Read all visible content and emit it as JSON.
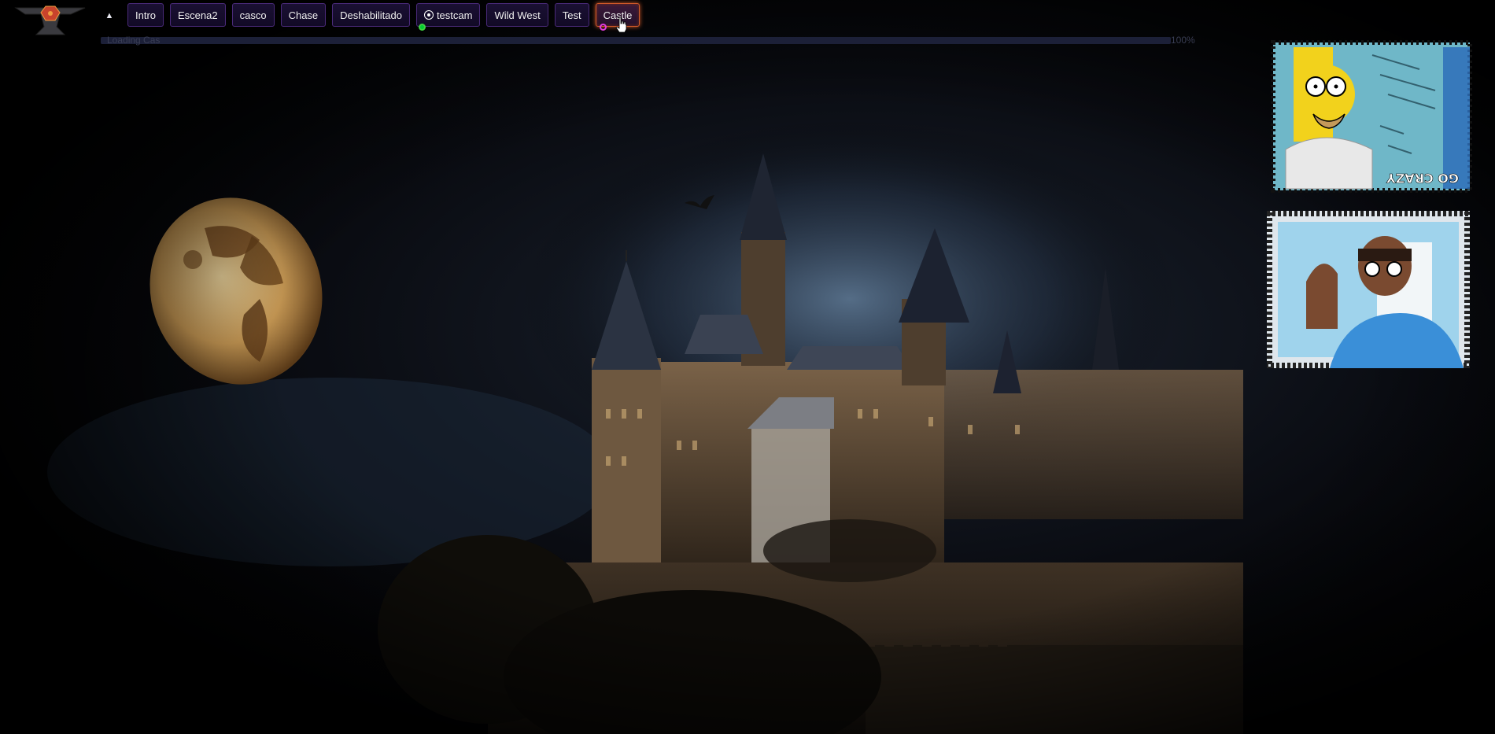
{
  "toolbar": {
    "collapse_icon": "caret-up-icon",
    "scenes": [
      {
        "label": "Intro",
        "active": false,
        "icon": "",
        "indicator": ""
      },
      {
        "label": "Escena2",
        "active": false,
        "icon": "",
        "indicator": ""
      },
      {
        "label": "casco",
        "active": false,
        "icon": "",
        "indicator": ""
      },
      {
        "label": "Chase",
        "active": false,
        "icon": "",
        "indicator": ""
      },
      {
        "label": "Deshabilitado",
        "active": false,
        "icon": "",
        "indicator": ""
      },
      {
        "label": "testcam",
        "active": false,
        "icon": "camera-target-icon",
        "indicator": "green"
      },
      {
        "label": "Wild West",
        "active": false,
        "icon": "",
        "indicator": ""
      },
      {
        "label": "Test",
        "active": false,
        "icon": "",
        "indicator": ""
      },
      {
        "label": "Castle",
        "active": true,
        "icon": "",
        "indicator": "magenta"
      }
    ]
  },
  "loading": {
    "label": "Loading Cas",
    "percent_text": "100%",
    "progress": 1.0
  },
  "tokens": [
    {
      "name": "homer-token",
      "caption": "GO CRAZY"
    },
    {
      "name": "cartoon-man-token",
      "caption": ""
    }
  ],
  "colors": {
    "tab_border": "#4a2a7a",
    "tab_active_border": "#d25a2a",
    "indicator_green": "#3fd13f",
    "indicator_magenta": "#e03ae0"
  }
}
